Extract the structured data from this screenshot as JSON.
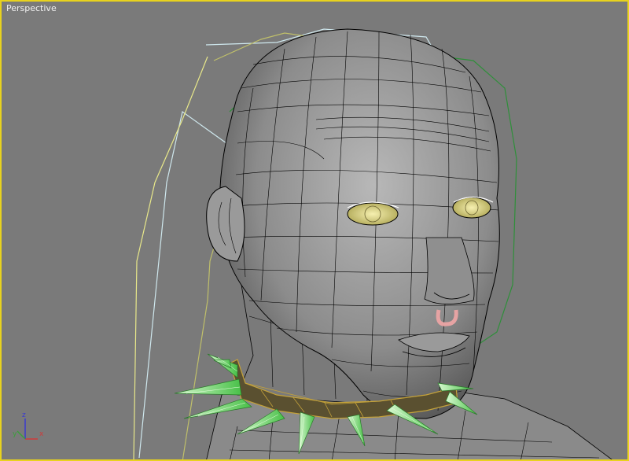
{
  "viewport": {
    "label": "Perspective",
    "border_color": "#e8d21e",
    "background_color": "#7a7a7a"
  },
  "scene": {
    "subject": "wireframe-head-model",
    "mesh_color": "#000000",
    "skin_color": "#8a8a8a",
    "eye_color": "#d8d27a",
    "collar_color": "#c4a23a",
    "spike_color": "#7ee07a",
    "nose_ring_color": "#e6a3a3",
    "hair_spline_colors": [
      "#cfe8ee",
      "#bfbf6a",
      "#2f8f3a",
      "#e8e88a"
    ]
  },
  "axis_tripod": {
    "x_label": "x",
    "y_label": "y",
    "z_label": "z",
    "x_color": "#d03a3a",
    "y_color": "#3aa03a",
    "z_color": "#3a3ad0"
  }
}
